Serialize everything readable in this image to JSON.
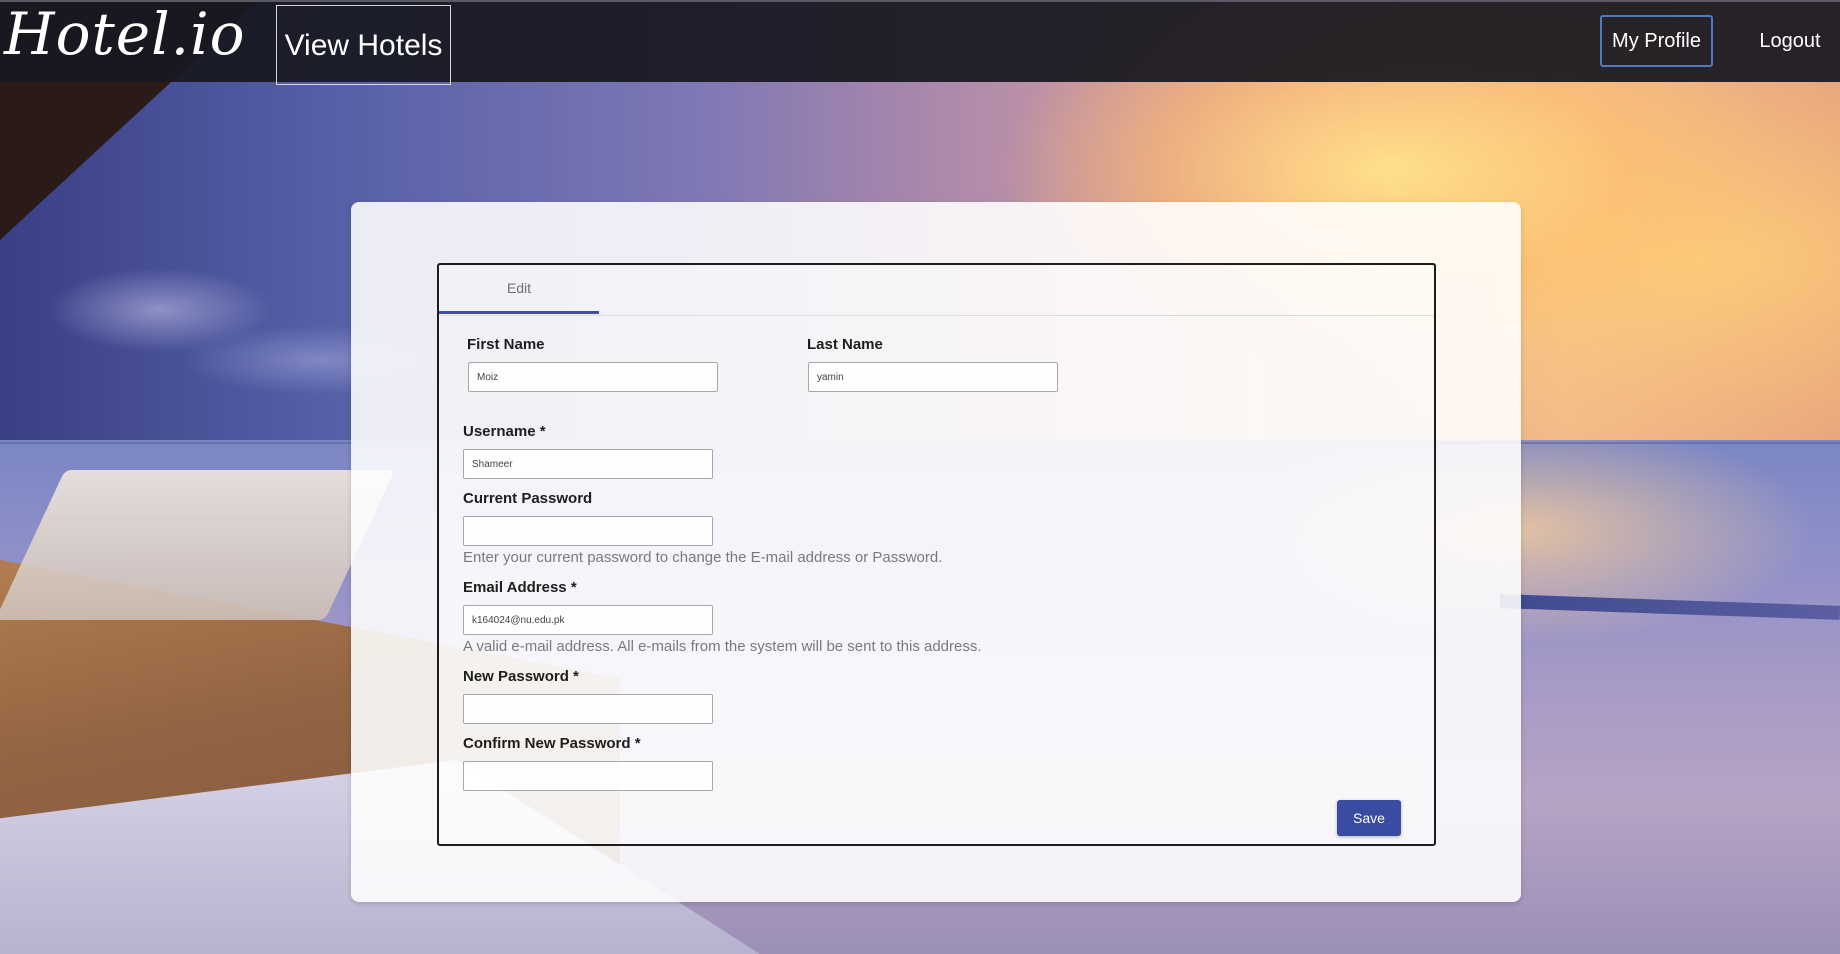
{
  "navbar": {
    "logo": "Hotel.io",
    "view_hotels": "View Hotels",
    "my_profile": "My Profile",
    "logout": "Logout"
  },
  "form": {
    "tab_edit": "Edit",
    "first_name": {
      "label": "First Name",
      "value": "Moiz"
    },
    "last_name": {
      "label": "Last Name",
      "value": "yamin"
    },
    "username": {
      "label": "Username *",
      "value": "Shameer"
    },
    "current_password": {
      "label": "Current Password",
      "value": "",
      "help": "Enter your current password to change the E-mail address or Password."
    },
    "email": {
      "label": "Email Address *",
      "value": "k164024@nu.edu.pk",
      "help": "A valid e-mail address. All e-mails from the system will be sent to this address."
    },
    "new_password": {
      "label": "New Password *",
      "value": ""
    },
    "confirm_password": {
      "label": "Confirm New Password *",
      "value": ""
    },
    "save_label": "Save"
  },
  "colors": {
    "navbar_bg": "#18181f",
    "accent": "#3a4ba2",
    "profile_border": "#4d79c5"
  }
}
